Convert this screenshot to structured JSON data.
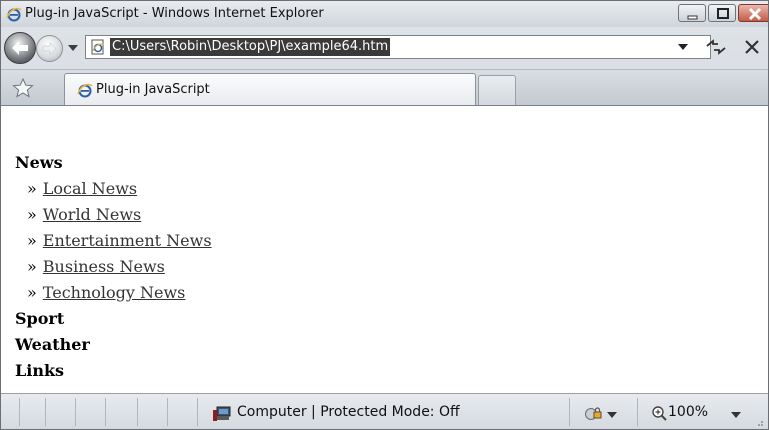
{
  "window": {
    "title": "Plug-in JavaScript - Windows Internet Explorer"
  },
  "address_bar": {
    "url": "C:\\Users\\Robin\\Desktop\\PJ\\example64.htm"
  },
  "tabs": [
    {
      "label": "Plug-in JavaScript",
      "active": true
    }
  ],
  "page": {
    "menu": [
      {
        "heading": "News",
        "items": [
          {
            "marker": "»",
            "label": "Local News"
          },
          {
            "marker": "»",
            "label": "World News"
          },
          {
            "marker": "»",
            "label": "Entertainment News"
          },
          {
            "marker": "»",
            "label": "Business News"
          },
          {
            "marker": "»",
            "label": "Technology News"
          }
        ]
      },
      {
        "heading": "Sport"
      },
      {
        "heading": "Weather"
      },
      {
        "heading": "Links"
      }
    ]
  },
  "status_bar": {
    "zone_text": "Computer | Protected Mode: Off",
    "zoom": "100%"
  },
  "icons": {
    "browser": "ie-icon",
    "back": "back-arrow-icon",
    "forward": "forward-arrow-icon",
    "refresh": "refresh-icon",
    "stop": "stop-icon",
    "favorites": "star-icon",
    "zone": "computer-icon",
    "security": "security-icon",
    "zoom": "magnifier-icon"
  }
}
